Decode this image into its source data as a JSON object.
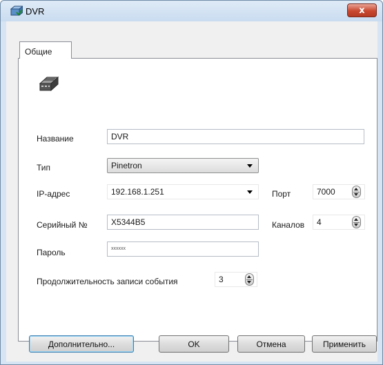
{
  "window": {
    "title": "DVR",
    "close_label": "x"
  },
  "tabs": [
    {
      "label": "Общие",
      "selected": true
    }
  ],
  "form": {
    "name": {
      "label": "Название",
      "value": "DVR"
    },
    "type": {
      "label": "Тип",
      "value": "Pinetron"
    },
    "ip": {
      "label": "IP-адрес",
      "value": "192.168.1.251"
    },
    "port": {
      "label": "Порт",
      "value": "7000"
    },
    "serial": {
      "label": "Серийный №",
      "value": "X5344B5"
    },
    "channels": {
      "label": "Каналов",
      "value": "4"
    },
    "password": {
      "label": "Пароль",
      "value": "xxxxxx"
    },
    "event_duration": {
      "label": "Продолжительность записи события",
      "value": "3"
    }
  },
  "buttons": {
    "advanced": "Дополнительно...",
    "ok": "OK",
    "cancel": "Отмена",
    "apply": "Применить"
  },
  "colors": {
    "titlebar": "#c9dcf0",
    "close": "#c8472f",
    "client": "#f0f0f0",
    "panel": "#ffffff"
  },
  "icons": [
    "dvr-window-icon",
    "close-icon",
    "dvr-device-icon",
    "dropdown-arrow-icon",
    "spinner-icon"
  ]
}
